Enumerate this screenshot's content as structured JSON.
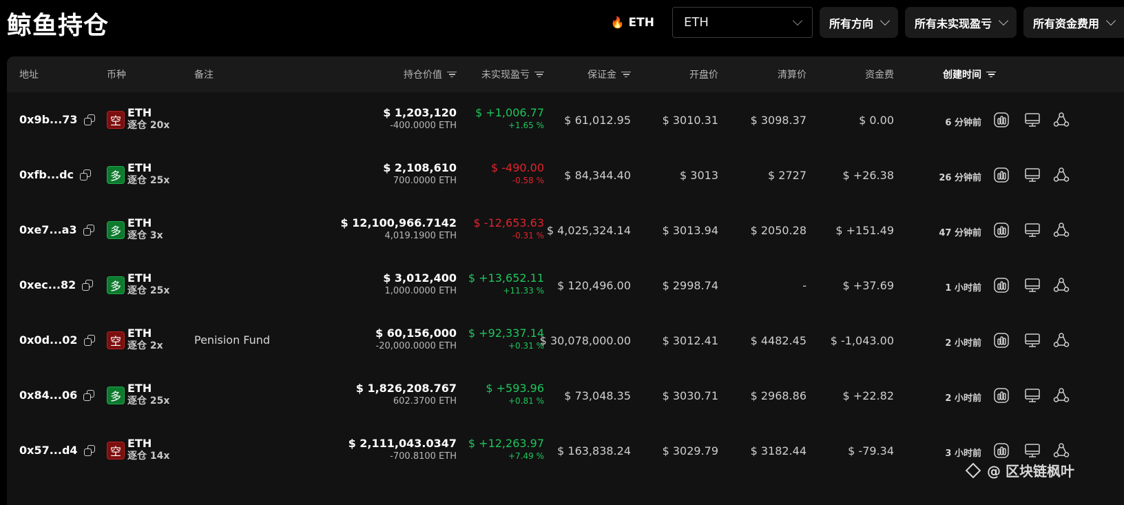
{
  "title": "鲸鱼持仓",
  "topbar": {
    "hot_coin": "ETH",
    "select_value": "ETH",
    "filters": [
      "所有方向",
      "所有未实现盈亏",
      "所有资金费用"
    ]
  },
  "columns": {
    "address": "地址",
    "coin": "币种",
    "note": "备注",
    "value": "持仓价值",
    "pnl": "未实现盈亏",
    "margin": "保证金",
    "open_price": "开盘价",
    "liq_price": "清算价",
    "funding": "资金费",
    "created": "创建时间"
  },
  "rows": [
    {
      "address": "0x9b...73",
      "side": "空",
      "side_type": "short",
      "coin": "ETH",
      "leverage": "逐仓 20x",
      "note": "",
      "value": "$ 1,203,120",
      "size": "-400.0000 ETH",
      "pnl": "$ +1,006.77",
      "pnl_pct": "+1.65 %",
      "pnl_sign": "pos",
      "margin": "$ 61,012.95",
      "open_price": "$ 3010.31",
      "liq_price": "$ 3098.37",
      "funding": "$ 0.00",
      "funding_sign": "neutral",
      "time": "6 分钟前"
    },
    {
      "address": "0xfb...dc",
      "side": "多",
      "side_type": "long",
      "coin": "ETH",
      "leverage": "逐仓 25x",
      "note": "",
      "value": "$ 2,108,610",
      "size": "700.0000 ETH",
      "pnl": "$ -490.00",
      "pnl_pct": "-0.58 %",
      "pnl_sign": "neg",
      "margin": "$ 84,344.40",
      "open_price": "$ 3013",
      "liq_price": "$ 2727",
      "funding": "$ +26.38",
      "funding_sign": "pos",
      "time": "26 分钟前"
    },
    {
      "address": "0xe7...a3",
      "side": "多",
      "side_type": "long",
      "coin": "ETH",
      "leverage": "逐仓 3x",
      "note": "",
      "value": "$ 12,100,966.7142",
      "size": "4,019.1900 ETH",
      "pnl": "$ -12,653.63",
      "pnl_pct": "-0.31 %",
      "pnl_sign": "neg",
      "margin": "$ 4,025,324.14",
      "open_price": "$ 3013.94",
      "liq_price": "$ 2050.28",
      "funding": "$ +151.49",
      "funding_sign": "pos",
      "time": "47 分钟前"
    },
    {
      "address": "0xec...82",
      "side": "多",
      "side_type": "long",
      "coin": "ETH",
      "leverage": "逐仓 25x",
      "note": "",
      "value": "$ 3,012,400",
      "size": "1,000.0000 ETH",
      "pnl": "$ +13,652.11",
      "pnl_pct": "+11.33 %",
      "pnl_sign": "pos",
      "margin": "$ 120,496.00",
      "open_price": "$ 2998.74",
      "liq_price": "-",
      "funding": "$ +37.69",
      "funding_sign": "pos",
      "time": "1 小时前"
    },
    {
      "address": "0x0d...02",
      "side": "空",
      "side_type": "short",
      "coin": "ETH",
      "leverage": "逐仓 2x",
      "note": "Penision Fund",
      "value": "$ 60,156,000",
      "size": "-20,000.0000 ETH",
      "pnl": "$ +92,337.14",
      "pnl_pct": "+0.31 %",
      "pnl_sign": "pos",
      "margin": "$ 30,078,000.00",
      "open_price": "$ 3012.41",
      "liq_price": "$ 4482.45",
      "funding": "$ -1,043.00",
      "funding_sign": "neg",
      "time": "2 小时前"
    },
    {
      "address": "0x84...06",
      "side": "多",
      "side_type": "long",
      "coin": "ETH",
      "leverage": "逐仓 25x",
      "note": "",
      "value": "$ 1,826,208.767",
      "size": "602.3700 ETH",
      "pnl": "$ +593.96",
      "pnl_pct": "+0.81 %",
      "pnl_sign": "pos",
      "margin": "$ 73,048.35",
      "open_price": "$ 3030.71",
      "liq_price": "$ 2968.86",
      "funding": "$ +22.82",
      "funding_sign": "pos",
      "time": "2 小时前"
    },
    {
      "address": "0x57...d4",
      "side": "空",
      "side_type": "short",
      "coin": "ETH",
      "leverage": "逐仓 14x",
      "note": "",
      "value": "$ 2,111,043.0347",
      "size": "-700.8100 ETH",
      "pnl": "$ +12,263.97",
      "pnl_pct": "+7.49 %",
      "pnl_sign": "pos",
      "margin": "$ 163,838.24",
      "open_price": "$ 3029.79",
      "liq_price": "$ 3182.44",
      "funding": "$ -79.34",
      "funding_sign": "neg",
      "time": "3 小时前"
    }
  ],
  "watermark": "@ 区块链枫叶",
  "colors": {
    "positive": "#1fc55c",
    "negative": "#e0242c",
    "long_badge": "#0d7a2e",
    "short_badge": "#7e0f0f"
  }
}
